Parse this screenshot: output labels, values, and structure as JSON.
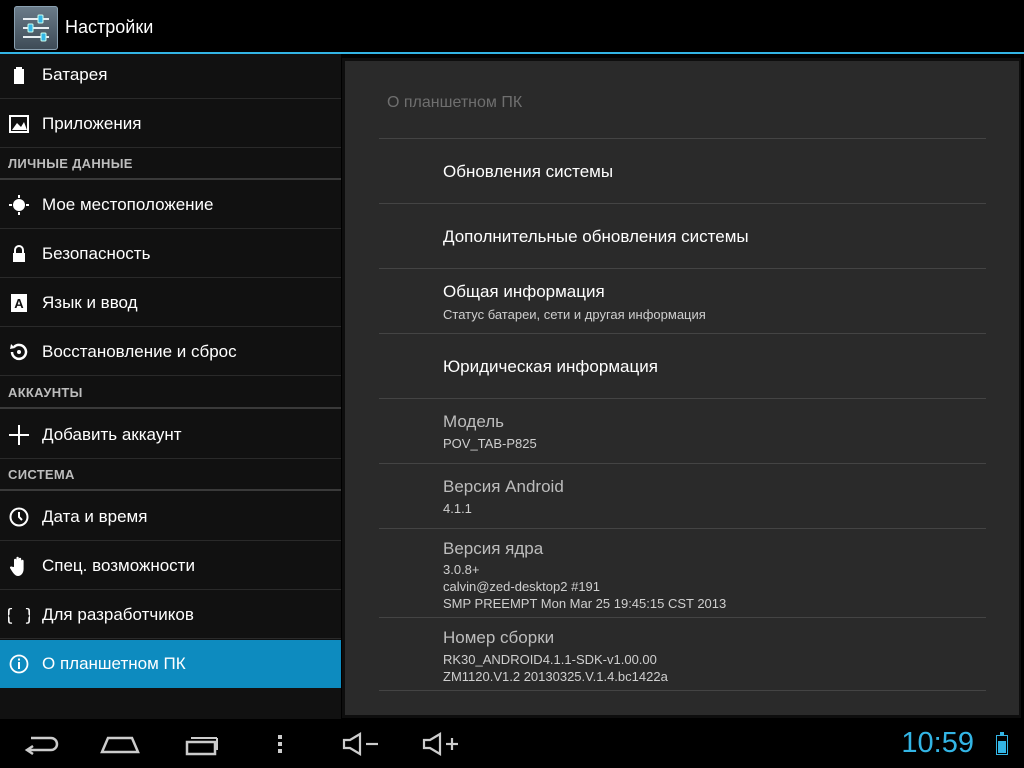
{
  "app": {
    "title": "Настройки"
  },
  "sidebar": {
    "items": [
      {
        "label": "Батарея",
        "icon": "battery-icon"
      },
      {
        "label": "Приложения",
        "icon": "apps-icon"
      },
      {
        "label": "Мое местоположение",
        "icon": "location-icon"
      },
      {
        "label": "Безопасность",
        "icon": "lock-icon"
      },
      {
        "label": "Язык и ввод",
        "icon": "language-icon"
      },
      {
        "label": "Восстановление и сброс",
        "icon": "restore-icon"
      },
      {
        "label": "Добавить аккаунт",
        "icon": "plus-icon"
      },
      {
        "label": "Дата и время",
        "icon": "clock-icon"
      },
      {
        "label": "Спец. возможности",
        "icon": "hand-icon"
      },
      {
        "label": "Для разработчиков",
        "icon": "braces-icon"
      },
      {
        "label": "О планшетном ПК",
        "icon": "info-icon"
      }
    ],
    "headers": [
      "ЛИЧНЫЕ ДАННЫЕ",
      "АККАУНТЫ",
      "СИСТЕМА"
    ],
    "selected": "О планшетном ПК"
  },
  "detail": {
    "title": "О планшетном ПК",
    "rows": [
      {
        "title": "Обновления системы"
      },
      {
        "title": "Дополнительные обновления системы"
      },
      {
        "title": "Общая информация",
        "summary": "Статус батареи, сети и другая информация"
      },
      {
        "title": "Юридическая информация"
      },
      {
        "title": "Модель",
        "summary": "POV_TAB-P825"
      },
      {
        "title": "Версия Android",
        "summary": "4.1.1"
      },
      {
        "title": "Версия ядра",
        "lines": [
          "3.0.8+",
          "calvin@zed-desktop2 #191",
          "SMP PREEMPT Mon Mar 25 19:45:15 CST 2013"
        ]
      },
      {
        "title": "Номер сборки",
        "lines": [
          "RK30_ANDROID4.1.1-SDK-v1.00.00",
          "ZM1120.V1.2 20130325.V.1.4.bc1422a"
        ]
      }
    ]
  },
  "navbar": {
    "time": "10:59",
    "buttons": [
      "back-icon",
      "home-icon",
      "recent-apps-icon",
      "menu-icon",
      "volume-down-icon",
      "volume-up-icon"
    ]
  },
  "colors": {
    "accent": "#33b5e5",
    "selected": "#0d8bbf",
    "pane": "#2a2a2a"
  }
}
